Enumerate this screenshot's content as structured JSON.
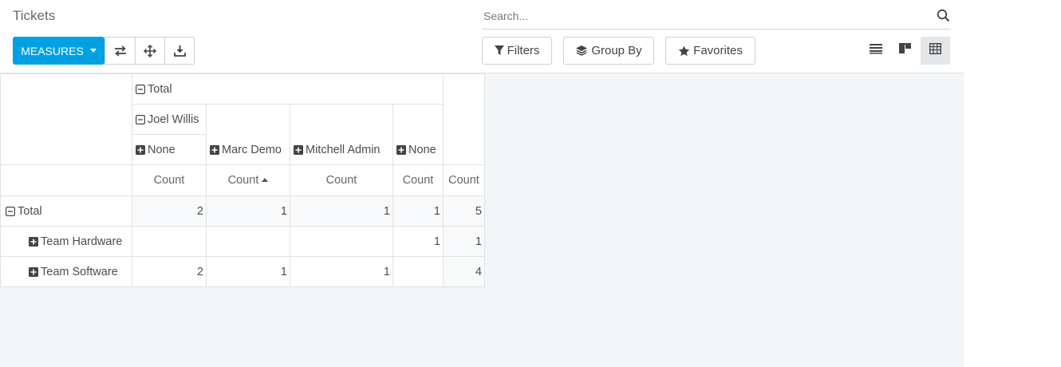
{
  "title": "Tickets",
  "search": {
    "placeholder": "Search..."
  },
  "toolbar": {
    "measures_label": "MEASURES",
    "filters_label": "Filters",
    "group_by_label": "Group By",
    "favorites_label": "Favorites"
  },
  "colors": {
    "primary": "#00a1e4",
    "background": "#f2f6f9"
  },
  "pivot": {
    "col_total_label": "Total",
    "col_group_label": "Joel Willis",
    "col_labels": [
      "None",
      "Marc Demo",
      "Mitchell Admin",
      "None"
    ],
    "measure_label": "Count",
    "rows": [
      {
        "label": "Total",
        "values": [
          "2",
          "1",
          "1",
          "1",
          "5"
        ]
      },
      {
        "label": "Team Hardware",
        "values": [
          "",
          "",
          "",
          "1",
          "1"
        ]
      },
      {
        "label": "Team Software",
        "values": [
          "2",
          "1",
          "1",
          "",
          "4"
        ]
      }
    ]
  }
}
